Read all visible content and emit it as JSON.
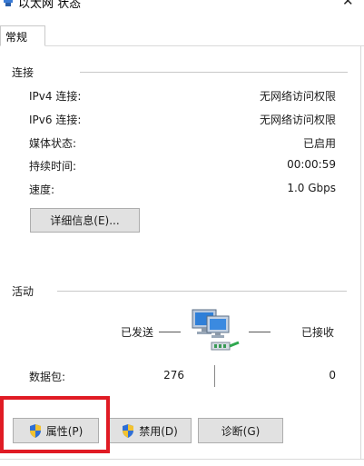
{
  "window": {
    "title": "以太网 状态",
    "icon": "network-adapter-icon",
    "close_glyph": "✕"
  },
  "tabs": [
    {
      "label": "常规",
      "active": true
    }
  ],
  "connection": {
    "group_label": "连接",
    "rows": [
      {
        "label": "IPv4 连接:",
        "value": "无网络访问权限"
      },
      {
        "label": "IPv6 连接:",
        "value": "无网络访问权限"
      },
      {
        "label": "媒体状态:",
        "value": "已启用"
      },
      {
        "label": "持续时间:",
        "value": "00:00:59"
      },
      {
        "label": "速度:",
        "value": "1.0 Gbps"
      }
    ],
    "details_button": "详细信息(E)..."
  },
  "activity": {
    "group_label": "活动",
    "sent_label": "已发送",
    "received_label": "已接收",
    "packets_label": "数据包:",
    "packets_sent": "276",
    "packets_received": "0",
    "icon": "network-computers-icon"
  },
  "buttons": {
    "properties": "属性(P)",
    "disable": "禁用(D)",
    "diagnose": "诊断(G)"
  },
  "colors": {
    "highlight": "#e01b24",
    "button_bg": "#e1e1e1",
    "separator": "#c8c8c8"
  }
}
